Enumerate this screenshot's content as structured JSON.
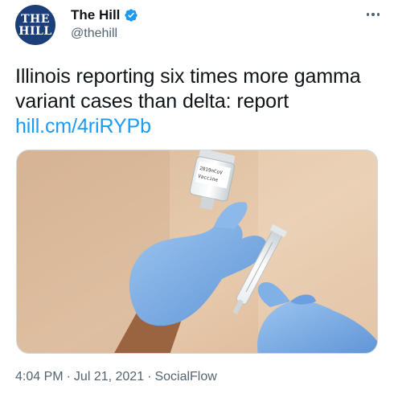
{
  "account": {
    "avatar_line1": "THE",
    "avatar_line2": "HILL",
    "display_name": "The Hill",
    "handle": "@thehill",
    "verified": true
  },
  "tweet": {
    "text": "Illinois reporting six times more gamma variant cases than delta: report ",
    "link_text": "hill.cm/4riRYPb",
    "media": {
      "vial_label_line1": "2019nCoV",
      "vial_label_line2": "Vaccine"
    }
  },
  "meta": {
    "time": "4:04 PM",
    "separator": "·",
    "date": "Jul 21, 2021",
    "source": "SocialFlow"
  },
  "colors": {
    "link": "#1d9bf0",
    "avatar_bg": "#1c3f7a",
    "verified": "#1d9bf0",
    "glove": "#7aaee6"
  },
  "icons": {
    "verified": "verified-badge-icon",
    "more": "more-dots-icon"
  }
}
